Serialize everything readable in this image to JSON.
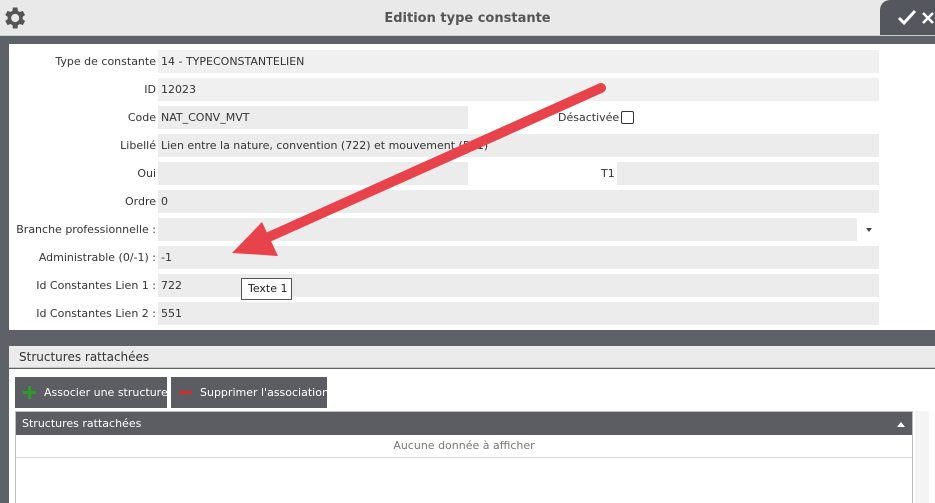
{
  "window": {
    "title": "Edition type constante"
  },
  "form": {
    "type_constante": {
      "label": "Type de constante",
      "value": "14 - TYPECONSTANTELIEN"
    },
    "id": {
      "label": "ID",
      "value": "12023"
    },
    "code": {
      "label": "Code",
      "value": "NAT_CONV_MVT"
    },
    "desactivee": {
      "label": "Désactivée",
      "checked": false
    },
    "libelle": {
      "label": "Libellé",
      "value": "Lien entre la nature, convention (722) et mouvement (551)"
    },
    "oui": {
      "label": "Oui",
      "value": ""
    },
    "t1": {
      "label": "T1",
      "value": ""
    },
    "ordre": {
      "label": "Ordre",
      "value": "0"
    },
    "branche": {
      "label": "Branche professionnelle :",
      "value": ""
    },
    "administrable": {
      "label": "Administrable (0/-1) :",
      "value": "-1"
    },
    "lien1": {
      "label": "Id Constantes Lien 1 :",
      "value": "722"
    },
    "lien2": {
      "label": "Id Constantes Lien 2 :",
      "value": "551"
    }
  },
  "tooltip": {
    "text": "Texte 1"
  },
  "structures": {
    "section_title": "Structures rattachées",
    "add_button": "Associer une structure",
    "remove_button": "Supprimer l'association",
    "grid_header": "Structures rattachées",
    "empty_text": "Aucune donnée à afficher"
  },
  "colors": {
    "accent_dark": "#5b5d63",
    "annotation_arrow": "#e8434b",
    "add_icon": "#2e9b2e",
    "remove_icon": "#d62b2b"
  }
}
